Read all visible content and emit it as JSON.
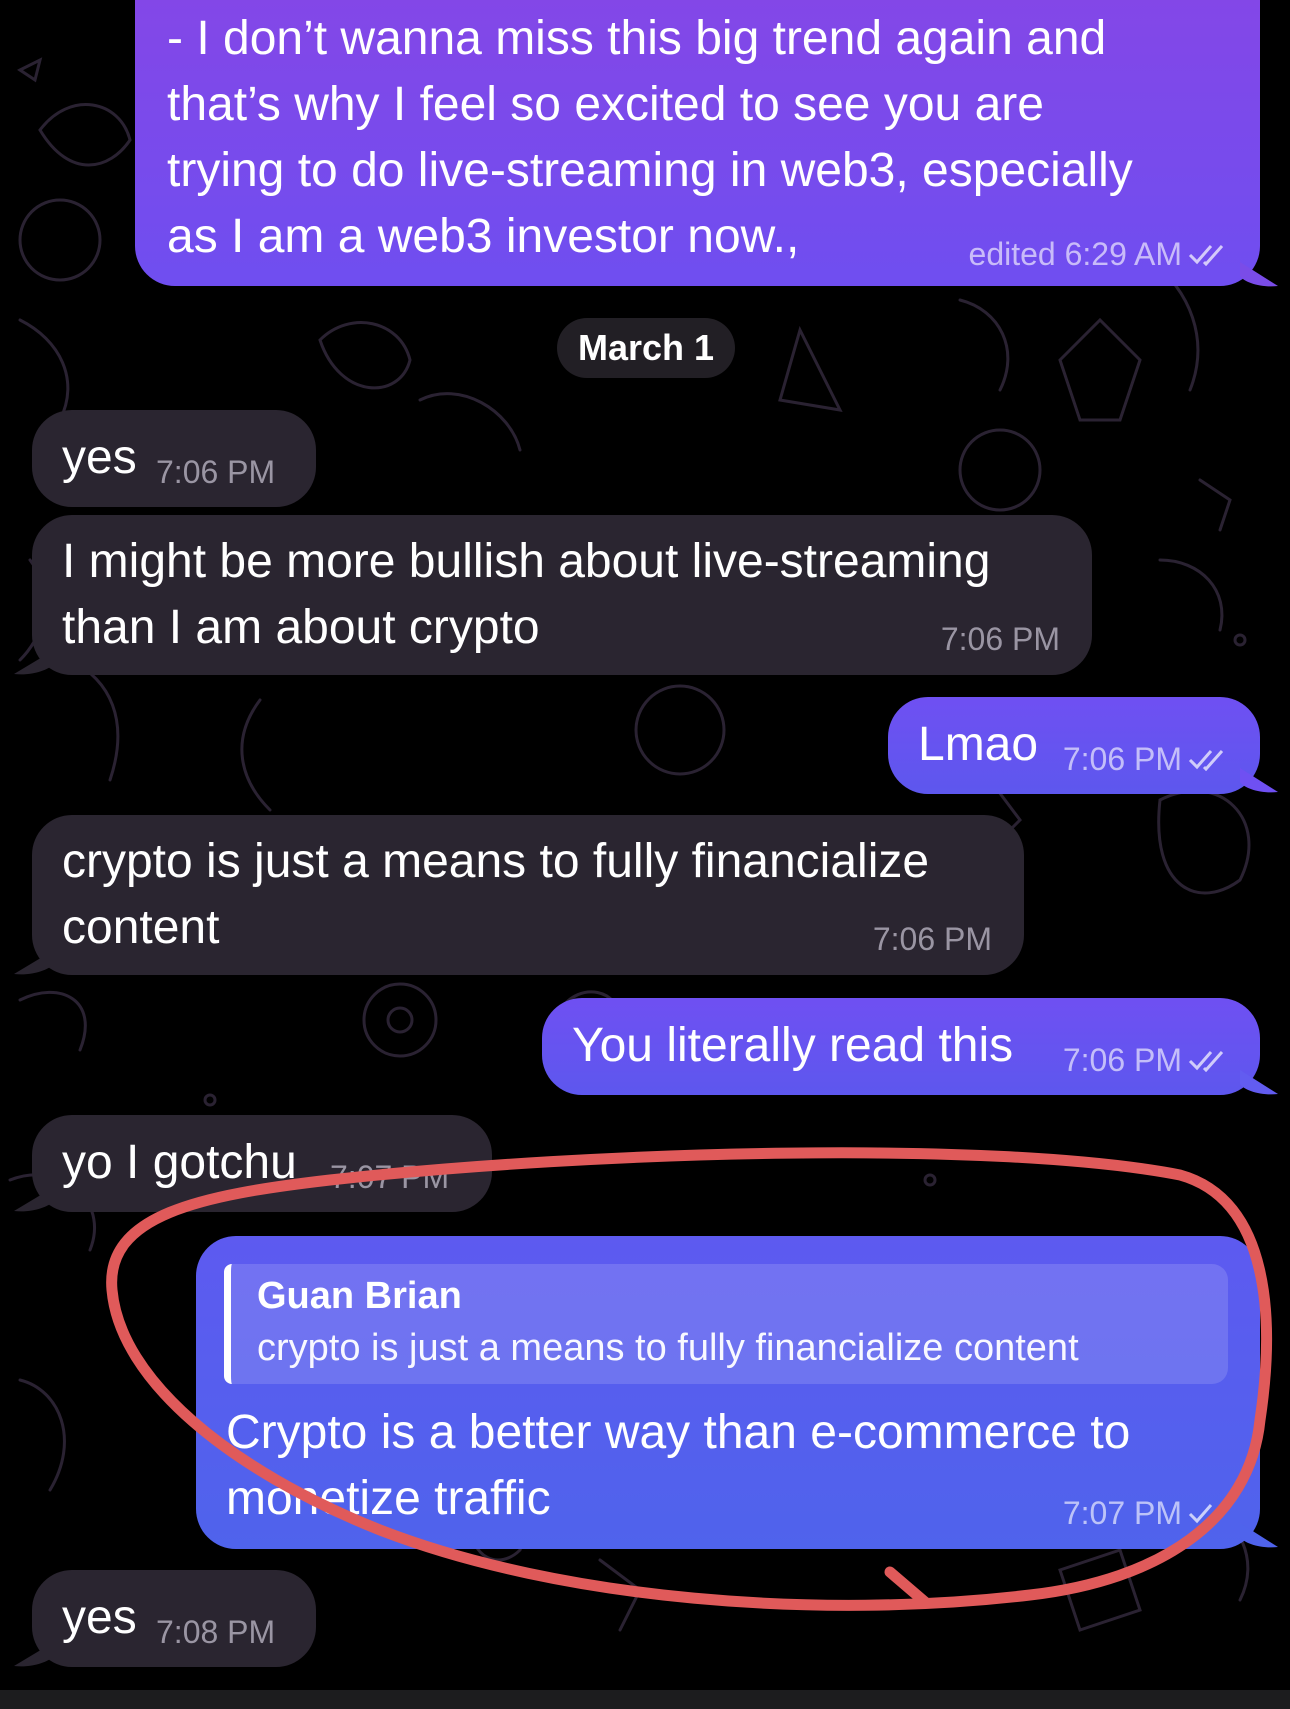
{
  "messages": [
    {
      "side": "out",
      "text": "- I don’t wanna miss this big trend again and that’s why I feel so excited to see you are trying to do live-streaming in web3, especially as I am a web3 investor now.,",
      "time": "edited 6:29 AM"
    },
    {
      "side": "date",
      "text": "March 1"
    },
    {
      "side": "in",
      "text": "yes",
      "time": "7:06 PM"
    },
    {
      "side": "in",
      "text": "I might be more bullish about live-streaming than I am about crypto",
      "time": "7:06 PM"
    },
    {
      "side": "out",
      "text": "Lmao",
      "time": "7:06 PM"
    },
    {
      "side": "in",
      "text": "crypto is just a means to fully financialize content",
      "time": "7:06 PM"
    },
    {
      "side": "out",
      "text": "You literally read this",
      "time": "7:06 PM"
    },
    {
      "side": "in",
      "text": "yo I gotchu",
      "time": "7:07 PM"
    },
    {
      "side": "out",
      "reply_to": {
        "name": "Guan Brian",
        "text": "crypto is just a means to fully financialize content"
      },
      "text": "Crypto is a better way than e-commerce to monetize traffic",
      "time": "7:07 PM"
    },
    {
      "side": "in",
      "text": "yes",
      "time": "7:08 PM"
    }
  ],
  "colors": {
    "background": "#000000",
    "incoming_bubble": "#2a2530",
    "outgoing_bubble_top": "#8646e6",
    "outgoing_bubble_bottom": "#4f63ec",
    "annotation_circle": "#e05a5a"
  },
  "icons": {
    "read_receipt": "double-check-icon",
    "background_pattern": "doodle-pattern"
  }
}
